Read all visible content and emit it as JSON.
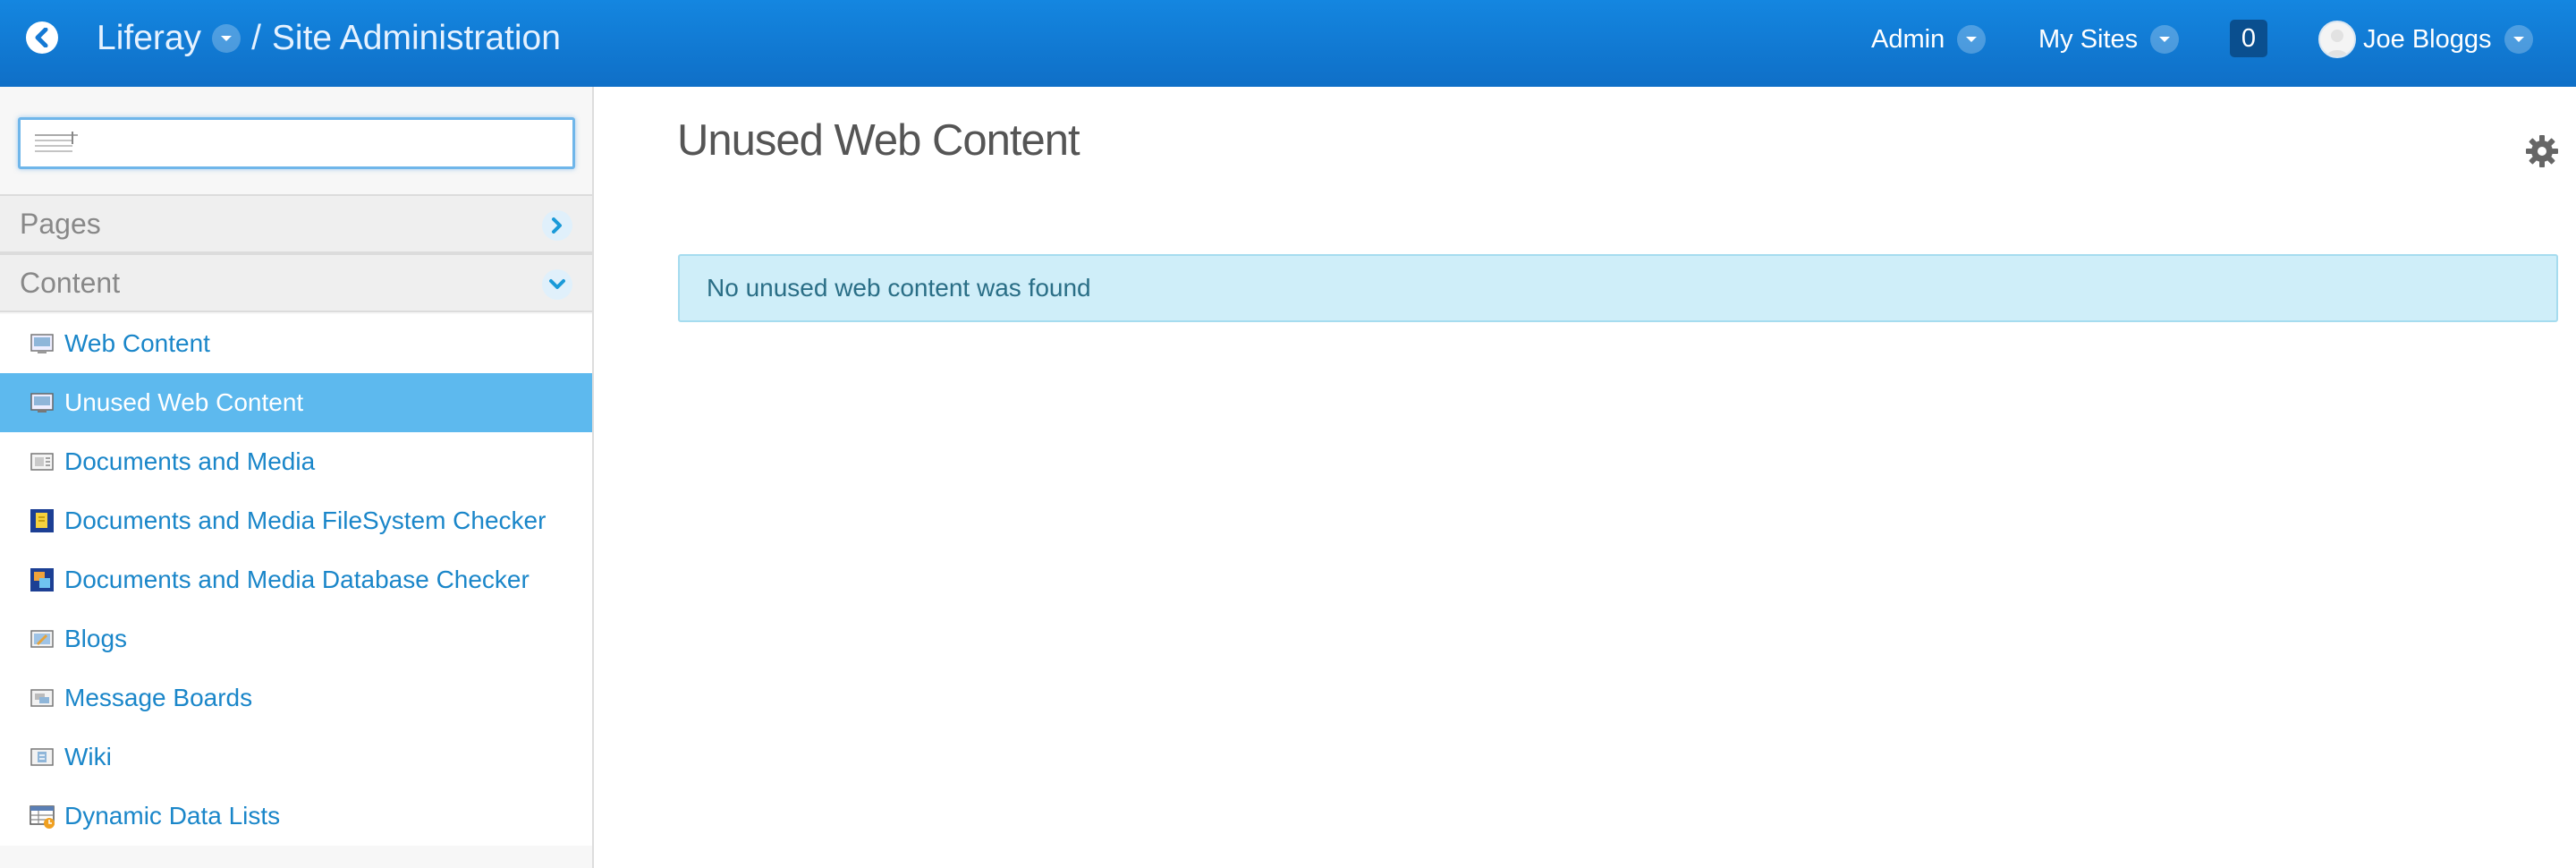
{
  "header": {
    "site_name": "Liferay",
    "separator": "/",
    "section": "Site Administration",
    "admin_label": "Admin",
    "my_sites_label": "My Sites",
    "notification_count": "0",
    "user_name": "Joe Bloggs"
  },
  "sidebar": {
    "search": {
      "value": "",
      "placeholder": ""
    },
    "panels": [
      {
        "label": "Pages",
        "expanded": false
      },
      {
        "label": "Content",
        "expanded": true
      }
    ],
    "items": [
      {
        "label": "Web Content",
        "icon": "web-content-icon",
        "active": false
      },
      {
        "label": "Unused Web Content",
        "icon": "unused-web-content-icon",
        "active": true
      },
      {
        "label": "Documents and Media",
        "icon": "documents-media-icon",
        "active": false
      },
      {
        "label": "Documents and Media FileSystem Checker",
        "icon": "filesystem-checker-icon",
        "active": false
      },
      {
        "label": "Documents and Media Database Checker",
        "icon": "database-checker-icon",
        "active": false
      },
      {
        "label": "Blogs",
        "icon": "blogs-icon",
        "active": false
      },
      {
        "label": "Message Boards",
        "icon": "message-boards-icon",
        "active": false
      },
      {
        "label": "Wiki",
        "icon": "wiki-icon",
        "active": false
      },
      {
        "label": "Dynamic Data Lists",
        "icon": "dynamic-data-lists-icon",
        "active": false
      }
    ]
  },
  "main": {
    "title": "Unused Web Content",
    "alert_message": "No unused web content was found"
  },
  "colors": {
    "topbar": "#1486e0",
    "link": "#1a86c9",
    "active_item": "#5db9ee",
    "alert_bg": "#cfeef9"
  }
}
